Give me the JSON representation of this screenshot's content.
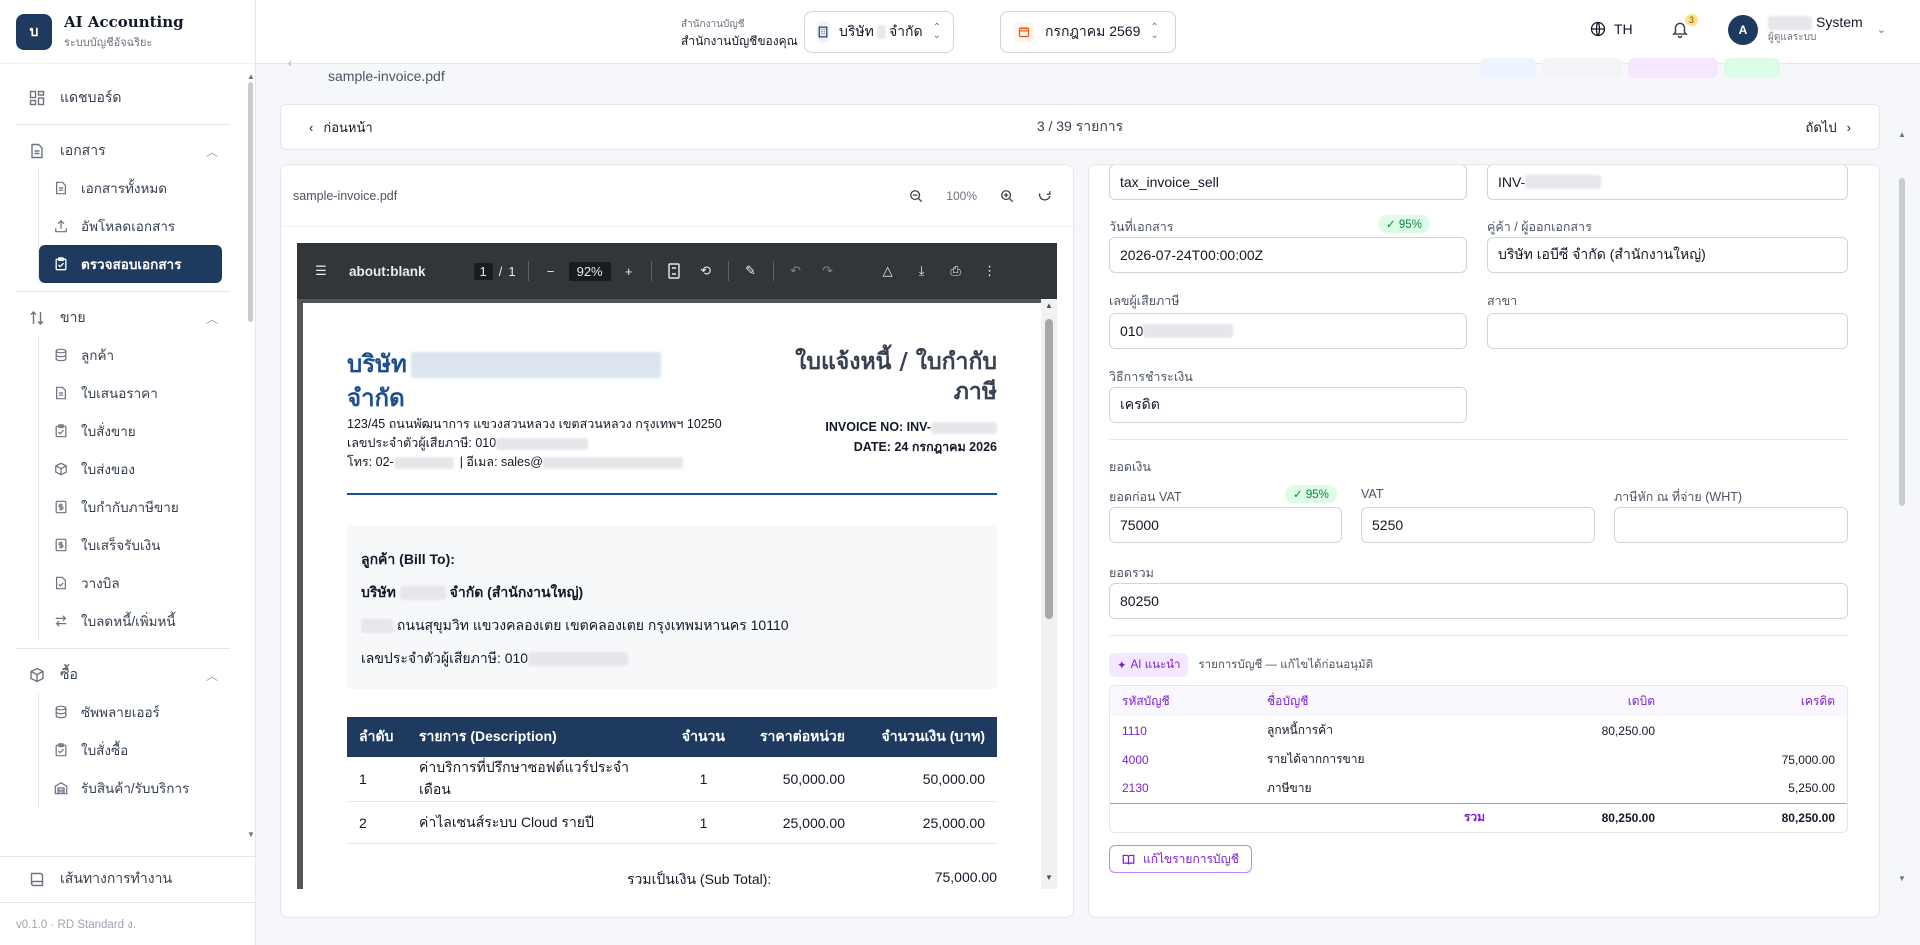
{
  "brand": {
    "logo": "บ",
    "title": "AI Accounting",
    "subtitle": "ระบบบัญชีอัจฉริยะ"
  },
  "sidebar": {
    "dashboard": "แดชบอร์ด",
    "documents": {
      "label": "เอกสาร",
      "items": [
        "เอกสารทั้งหมด",
        "อัพโหลดเอกสาร",
        "ตรวจสอบเอกสาร"
      ]
    },
    "sales": {
      "label": "ขาย",
      "items": [
        "ลูกค้า",
        "ใบเสนอราคา",
        "ใบสั่งขาย",
        "ใบส่งของ",
        "ใบกำกับภาษีขาย",
        "ใบเสร็จรับเงิน",
        "วางบิล",
        "ใบลดหนี้/เพิ่มหนี้"
      ]
    },
    "purchases": {
      "label": "ซื้อ",
      "items": [
        "ซัพพลายเออร์",
        "ใบสั่งซื้อ",
        "รับสินค้า/รับบริการ"
      ]
    },
    "workflow": "เส้นทางการทำงาน",
    "version": "v0.1.0 · RD Standard ง."
  },
  "header": {
    "office_small": "สำนักงานบัญชี",
    "office_name": "สำนักงานบัญชีของคุณ",
    "company_prefix": "บริษัท",
    "company_suffix": "จำกัด",
    "period": "กรกฎาคม 2569",
    "lang": "TH",
    "notif_count": "3",
    "user_initial": "A",
    "user_name": "System",
    "user_role": "ผู้ดูแลระบบ"
  },
  "review": {
    "file_name": "sample-invoice.pdf",
    "prev_label": "ก่อนหน้า",
    "next_label": "ถัดไป",
    "counter": "3 / 39 รายการ"
  },
  "viewer": {
    "file_name": "sample-invoice.pdf",
    "zoom": "100%",
    "pdf_title": "about:blank",
    "page_current": "1",
    "page_total": "1",
    "pdf_zoom": "92%"
  },
  "invoice": {
    "company_line1": "บริษัท",
    "company_line2": "จำกัด",
    "title_line1": "ใบแจ้งหนี้ / ใบกำกับ",
    "title_line2": "ภาษี",
    "invoice_no": "INVOICE NO: INV-",
    "date": "DATE: 24 กรกฎาคม 2026",
    "address": "123/45 ถนนพัฒนาการ แขวงสวนหลวง เขตสวนหลวง กรุงเทพฯ 10250",
    "tax_id": "เลขประจำตัวผู้เสียภาษี: 010",
    "contact_phone": "โทร: 02-",
    "contact_email": "| อีเมล: sales@",
    "bill_to_title": "ลูกค้า (Bill To):",
    "bill_company_prefix": "บริษัท",
    "bill_company_suffix": "จำกัด (สำนักงานใหญ่)",
    "bill_address": "ถนนสุขุมวิท แขวงคลองเตย เขตคลองเตย กรุงเทพมหานคร 10110",
    "bill_tax": "เลขประจำตัวผู้เสียภาษี: 010",
    "columns": [
      "ลำดับ",
      "รายการ (Description)",
      "จำนวน",
      "ราคาต่อหน่วย",
      "จำนวนเงิน (บาท)"
    ],
    "rows": [
      {
        "no": "1",
        "desc": "ค่าบริการที่ปรึกษาซอฟต์แวร์ประจำเดือน",
        "qty": "1",
        "unit": "50,000.00",
        "amount": "50,000.00"
      },
      {
        "no": "2",
        "desc": "ค่าไลเซนส์ระบบ Cloud รายปี",
        "qty": "1",
        "unit": "25,000.00",
        "amount": "25,000.00"
      }
    ],
    "subtotal_label": "รวมเป็นเงิน (Sub Total):",
    "subtotal_value": "75,000.00"
  },
  "form": {
    "doc_type": "tax_invoice_sell",
    "doc_no_prefix": "INV-",
    "doc_date_label": "วันที่เอกสาร",
    "doc_date_conf": "✓ 95%",
    "doc_date": "2026-07-24T00:00:00Z",
    "party_label": "คู่ค้า / ผู้ออกเอกสาร",
    "party": "บริษัท เอบีซี จำกัด (สำนักงานใหญ่)",
    "tax_label": "เลขผู้เสียภาษี",
    "tax_prefix": "010",
    "branch_label": "สาขา",
    "branch": "",
    "payment_label": "วิธีการชำระเงิน",
    "payment": "เครดิต",
    "amount_section": "ยอดเงิน",
    "pre_vat_label": "ยอดก่อน VAT",
    "pre_vat_conf": "✓ 95%",
    "pre_vat": "75000",
    "vat_label": "VAT",
    "vat": "5250",
    "wht_label": "ภาษีหัก ณ ที่จ่าย (WHT)",
    "wht": "",
    "total_label": "ยอดรวม",
    "total": "80250",
    "ai_chip": "AI แนะนำ",
    "ai_note": "รายการบัญชี — แก้ไขได้ก่อนอนุมัติ",
    "journal_columns": [
      "รหัสบัญชี",
      "ชื่อบัญชี",
      "เดบิต",
      "เครดิต"
    ],
    "journal_rows": [
      {
        "code": "1110",
        "name": "ลูกหนี้การค้า",
        "debit": "80,250.00",
        "credit": ""
      },
      {
        "code": "4000",
        "name": "รายได้จากการขาย",
        "debit": "",
        "credit": "75,000.00"
      },
      {
        "code": "2130",
        "name": "ภาษีขาย",
        "debit": "",
        "credit": "5,250.00"
      }
    ],
    "journal_total_label": "รวม",
    "journal_total_debit": "80,250.00",
    "journal_total_credit": "80,250.00",
    "edit_label": "แก้ไขรายการบัญชี"
  }
}
